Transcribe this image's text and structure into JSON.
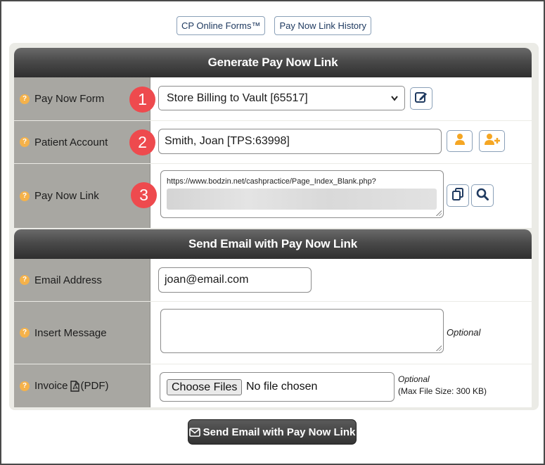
{
  "top_links": {
    "forms_label": "CP Online Forms™",
    "history_label": "Pay Now Link History"
  },
  "section1": {
    "title": "Generate Pay Now Link"
  },
  "pay_now_form": {
    "label": "Pay Now Form",
    "selected": "Store Billing to Vault [65517]",
    "badge": "1"
  },
  "patient_account": {
    "label": "Patient Account",
    "value": "Smith, Joan [TPS:63998]",
    "badge": "2"
  },
  "pay_now_link": {
    "label": "Pay Now Link",
    "url": "https://www.bodzin.net/cashpractice/Page_Index_Blank.php?",
    "badge": "3"
  },
  "section2": {
    "title": "Send Email with Pay Now Link"
  },
  "email_address": {
    "label": "Email Address",
    "value": "joan@email.com"
  },
  "insert_message": {
    "label": "Insert Message",
    "optional": "Optional"
  },
  "invoice": {
    "label": "Invoice",
    "label_suffix": "(PDF)",
    "choose_label": "Choose Files",
    "no_file": "No file chosen",
    "optional": "Optional",
    "max_size": "(Max File Size: 300 KB)"
  },
  "send_button": {
    "label": "Send Email with Pay Now Link"
  },
  "colors": {
    "badge": "#ee4a4e",
    "orange_icon": "#f5a623",
    "navy_icon": "#1f3a60",
    "label_bg": "#a8a7a2"
  },
  "icons": [
    "help-icon",
    "edit-icon",
    "person-icon",
    "add-person-icon",
    "copy-icon",
    "search-icon",
    "pdf-icon",
    "envelope-icon"
  ]
}
